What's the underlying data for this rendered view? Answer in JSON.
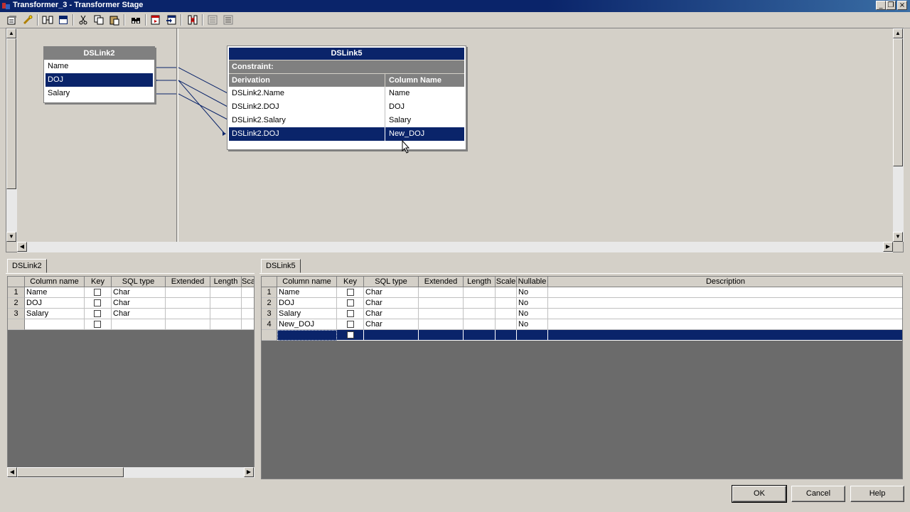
{
  "window": {
    "title": "Transformer_3 - Transformer Stage"
  },
  "toolbar": {
    "icons": [
      "stage-properties-icon",
      "constraints-icon",
      "show-all-icon",
      "show-links-icon",
      "cut-icon",
      "copy-icon",
      "paste-icon",
      "find-icon",
      "load-icon",
      "save-icon",
      "column-auto-match-icon",
      "input-link-order-icon",
      "output-link-order-icon"
    ]
  },
  "input_link": {
    "name": "DSLink2",
    "columns": [
      "Name",
      "DOJ",
      "Salary"
    ],
    "selected": "DOJ"
  },
  "output_link": {
    "name": "DSLink5",
    "constraint_label": "Constraint:",
    "headers": {
      "derivation": "Derivation",
      "column_name": "Column Name"
    },
    "rows": [
      {
        "derivation": "DSLink2.Name",
        "column": "Name"
      },
      {
        "derivation": "DSLink2.DOJ",
        "column": "DOJ"
      },
      {
        "derivation": "DSLink2.Salary",
        "column": "Salary"
      },
      {
        "derivation": "DSLink2.DOJ",
        "column": "New_DOJ"
      }
    ]
  },
  "left_grid": {
    "tab": "DSLink2",
    "headers": [
      "Column name",
      "Key",
      "SQL type",
      "Extended",
      "Length",
      "Sca"
    ],
    "rows": [
      {
        "num": "1",
        "name": "Name",
        "type": "Char"
      },
      {
        "num": "2",
        "name": "DOJ",
        "type": "Char"
      },
      {
        "num": "3",
        "name": "Salary",
        "type": "Char"
      }
    ]
  },
  "right_grid": {
    "tab": "DSLink5",
    "headers": [
      "Column name",
      "Key",
      "SQL type",
      "Extended",
      "Length",
      "Scale",
      "Nullable",
      "Description"
    ],
    "rows": [
      {
        "num": "1",
        "name": "Name",
        "type": "Char",
        "nullable": "No"
      },
      {
        "num": "2",
        "name": "DOJ",
        "type": "Char",
        "nullable": "No"
      },
      {
        "num": "3",
        "name": "Salary",
        "type": "Char",
        "nullable": "No"
      },
      {
        "num": "4",
        "name": "New_DOJ",
        "type": "Char",
        "nullable": "No"
      }
    ]
  },
  "buttons": {
    "ok": "OK",
    "cancel": "Cancel",
    "help": "Help"
  }
}
